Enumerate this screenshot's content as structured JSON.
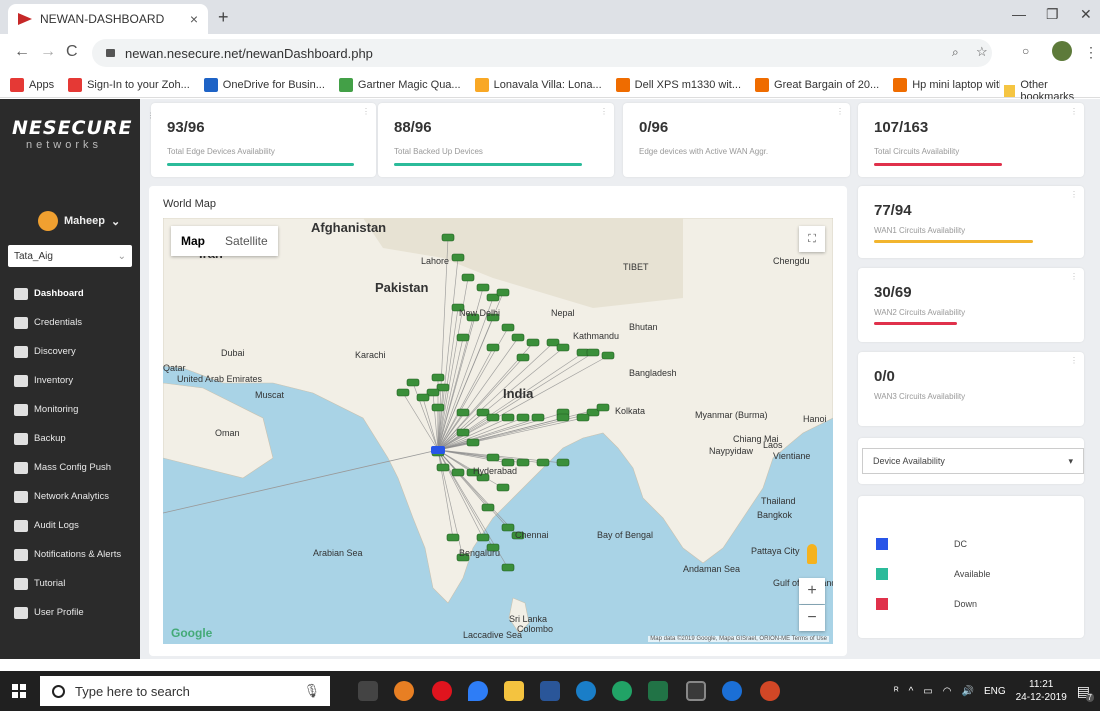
{
  "browser": {
    "tab_title": "NEWAN-DASHBOARD",
    "url": "newan.nesecure.net/newanDashboard.php",
    "bookmarks": [
      {
        "label": "Apps",
        "color": "#e53935"
      },
      {
        "label": "Sign-In to your Zoh...",
        "color": "#e53935"
      },
      {
        "label": "OneDrive for Busin...",
        "color": "#1e63c6"
      },
      {
        "label": "Gartner Magic Qua...",
        "color": "#43a047"
      },
      {
        "label": "Lonavala Villa: Lona...",
        "color": "#f9a825"
      },
      {
        "label": "Dell XPS m1330 wit...",
        "color": "#ef6c00"
      },
      {
        "label": "Great Bargain of 20...",
        "color": "#ef6c00"
      },
      {
        "label": "Hp mini laptop with...",
        "color": "#ef6c00"
      }
    ],
    "bookmarks_more": "»",
    "other_bookmarks": "Other bookmarks"
  },
  "sidebar": {
    "brand": "NESECURE",
    "brand_sub": "networks",
    "user": "Maheep",
    "tenant": "Tata_Aig",
    "items": [
      {
        "label": "Dashboard",
        "icon": "dashboard-icon"
      },
      {
        "label": "Credentials",
        "icon": "key-icon"
      },
      {
        "label": "Discovery",
        "icon": "search-icon"
      },
      {
        "label": "Inventory",
        "icon": "database-icon"
      },
      {
        "label": "Monitoring",
        "icon": "monitor-icon"
      },
      {
        "label": "Backup",
        "icon": "cloud-icon"
      },
      {
        "label": "Mass Config Push",
        "icon": "gears-icon"
      },
      {
        "label": "Network Analytics",
        "icon": "chart-icon"
      },
      {
        "label": "Audit Logs",
        "icon": "clipboard-icon"
      },
      {
        "label": "Notifications & Alerts",
        "icon": "warning-icon"
      },
      {
        "label": "Tutorial",
        "icon": "question-icon"
      },
      {
        "label": "User Profile",
        "icon": "user-icon"
      }
    ]
  },
  "stats": [
    {
      "value": "93/96",
      "label": "Total Edge Devices Availability",
      "fill": 0.97,
      "color": "#2bbb9a"
    },
    {
      "value": "88/96",
      "label": "Total Backed Up Devices",
      "fill": 0.92,
      "color": "#2bbb9a"
    },
    {
      "value": "0/96",
      "label": "Edge devices with Active WAN Aggr.",
      "fill": 0,
      "color": "#2bbb9a"
    },
    {
      "value": "107/163",
      "label": "Total Circuits Availability",
      "fill": 0.66,
      "color": "#e0314b"
    }
  ],
  "wan": [
    {
      "value": "77/94",
      "label": "WAN1 Circuits Availability",
      "fill": 0.82,
      "color": "#f2b52e"
    },
    {
      "value": "30/69",
      "label": "WAN2 Circuits Availability",
      "fill": 0.43,
      "color": "#e0314b"
    },
    {
      "value": "0/0",
      "label": "WAN3 Circuits Availability",
      "fill": 0,
      "color": "#e0314b"
    }
  ],
  "map": {
    "title": "World Map",
    "type_map": "Map",
    "type_satellite": "Satellite",
    "google": "Google",
    "attribution": "Map data ©2019 Google, Mapa GISrael, ORION-ME   Terms of Use",
    "labels": [
      "Afghanistan",
      "Iran",
      "Pakistan",
      "India",
      "Nepal",
      "Bhutan",
      "Bangladesh",
      "Myanmar (Burma)",
      "Thailand",
      "Laos",
      "Oman",
      "Qatar",
      "Dubai",
      "Muscat",
      "Karachi",
      "New Delhi",
      "Kolkata",
      "Hyderabad",
      "Bengaluru",
      "Chennai",
      "Sri Lanka",
      "Colombo",
      "Bangkok",
      "Chengdu",
      "Kathmandu",
      "United Arab Emirates",
      "Arabian Sea",
      "Bay of Bengal",
      "Andaman Sea",
      "Laccadive Sea",
      "TIBET",
      "Vientiane",
      "Naypyidaw",
      "Chiang Mai",
      "Pattaya City",
      "Gulf of Thailand",
      "Hanoi",
      "Lahore"
    ]
  },
  "filter": {
    "selected": "Device Availability"
  },
  "legend": [
    {
      "label": "DC",
      "color": "#2855e8"
    },
    {
      "label": "Available",
      "color": "#2bbb9a"
    },
    {
      "label": "Down",
      "color": "#e0314b"
    }
  ],
  "taskbar": {
    "search_placeholder": "Type here to search",
    "lang": "ENG",
    "time": "11:21",
    "date": "24-12-2019",
    "notif_count": "7"
  }
}
